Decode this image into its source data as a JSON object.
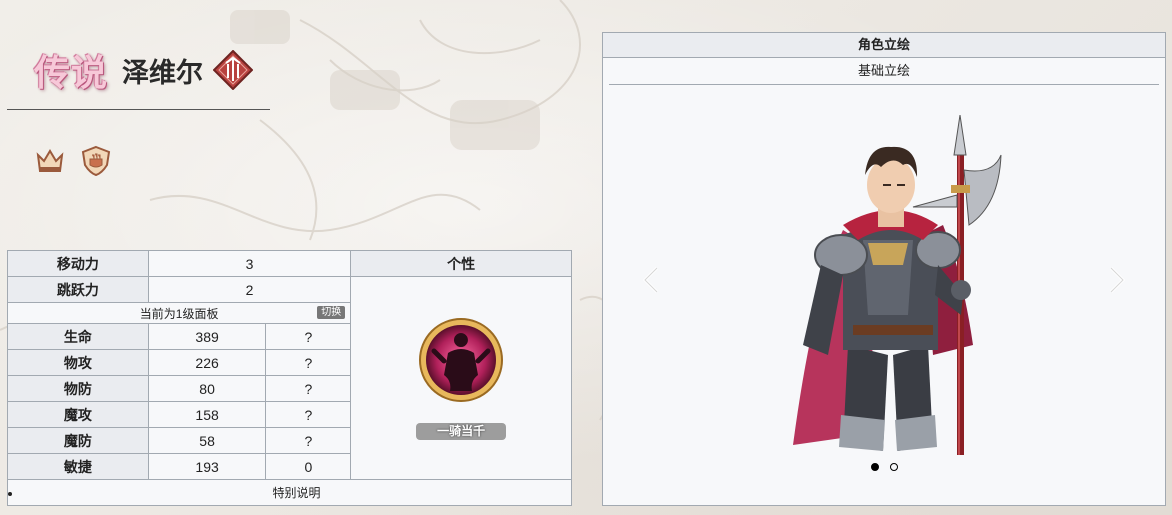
{
  "header": {
    "rarity": "传说",
    "name": "泽维尔",
    "class_icon": "spear-class-icon"
  },
  "badges": [
    {
      "icon": "crown-icon"
    },
    {
      "icon": "fist-shield-icon"
    }
  ],
  "stats": {
    "move_label": "移动力",
    "move_value": "3",
    "jump_label": "跳跃力",
    "jump_value": "2",
    "trait_header": "个性",
    "panel_note": "当前为1级面板",
    "switch_label": "切换",
    "rows": [
      {
        "label": "生命",
        "value": "389",
        "growth": "?"
      },
      {
        "label": "物攻",
        "value": "226",
        "growth": "?"
      },
      {
        "label": "物防",
        "value": "80",
        "growth": "?"
      },
      {
        "label": "魔攻",
        "value": "158",
        "growth": "?"
      },
      {
        "label": "魔防",
        "value": "58",
        "growth": "?"
      },
      {
        "label": "敏捷",
        "value": "193",
        "growth": "0"
      }
    ],
    "trait_name": "一骑当千",
    "notes": [
      "特别说明"
    ]
  },
  "portrait": {
    "title": "角色立绘",
    "subtitle": "基础立绘",
    "slides": 2,
    "active_slide": 0
  },
  "colors": {
    "border": "#a2a9b1",
    "header_bg": "#eaecf0",
    "rarity_pink": "#f7c8d8",
    "class_icon_red": "#b8423f"
  }
}
